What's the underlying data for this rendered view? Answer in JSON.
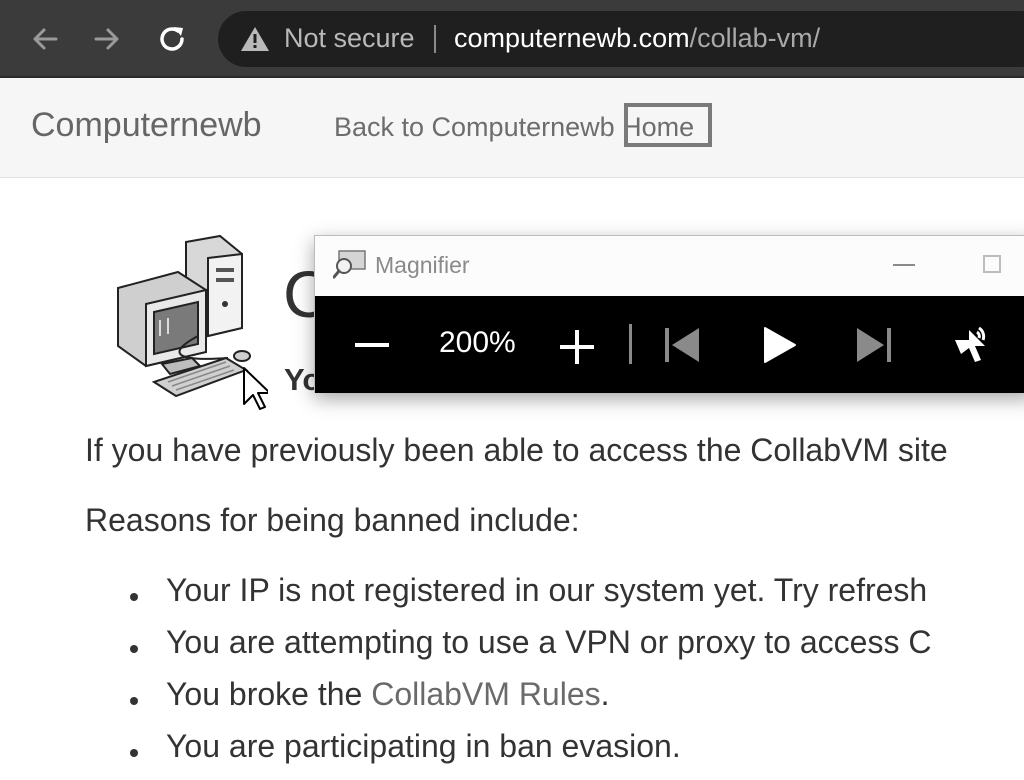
{
  "browser": {
    "security_status": "Not secure",
    "url_domain": "computernewb.com",
    "url_path": "/collab-vm/",
    "icons": [
      "back-arrow-icon",
      "forward-arrow-icon",
      "reload-icon",
      "warning-icon"
    ]
  },
  "site": {
    "brand": "Computernewb",
    "back_link": "Back to Computernewb Home"
  },
  "content": {
    "title": "C",
    "subtitle": "Yo",
    "paragraph_1": "If you have previously been able to access the CollabVM site",
    "paragraph_2": "Reasons for being banned include:",
    "bullets": [
      {
        "text": "Your IP is not registered in our system yet. Try refresh"
      },
      {
        "text": "You are attempting to use a VPN or proxy to access C"
      },
      {
        "prefix": "You broke the ",
        "link": "CollabVM Rules",
        "suffix": "."
      },
      {
        "text": "You are participating in ban evasion."
      }
    ]
  },
  "magnifier": {
    "title": "Magnifier",
    "zoom_level": "200%",
    "icons": [
      "zoom-out-icon",
      "zoom-in-icon",
      "previous-track-icon",
      "play-icon",
      "next-track-icon",
      "read-aloud-icon"
    ]
  }
}
